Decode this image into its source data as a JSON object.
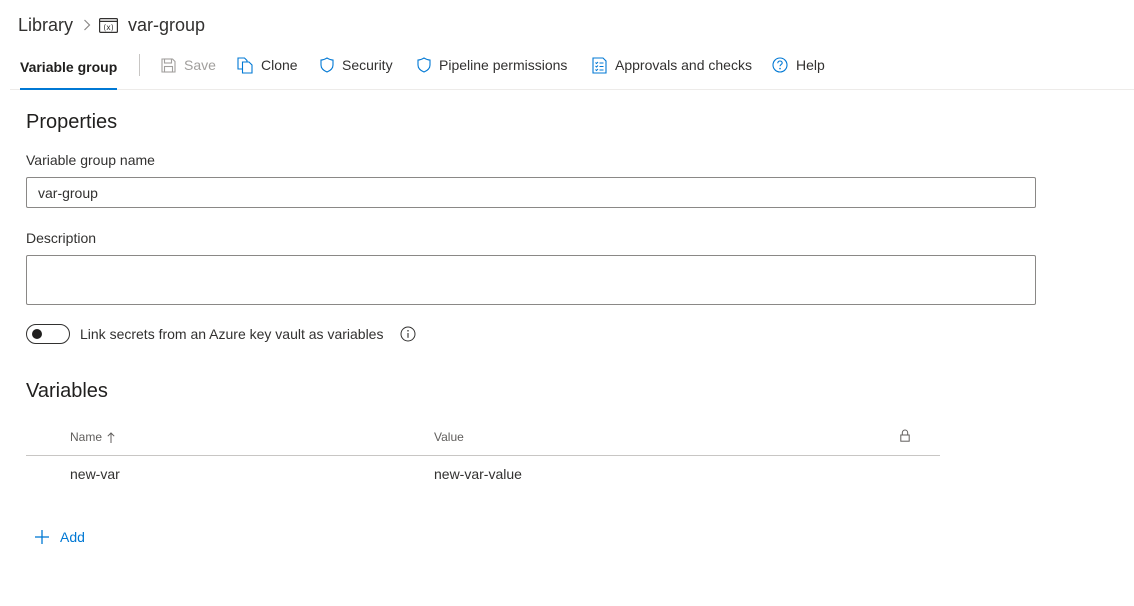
{
  "breadcrumb": {
    "root": "Library",
    "current": "var-group",
    "current_icon": "variable-group-icon"
  },
  "toolbar": {
    "active_tab": "Variable group",
    "save": "Save",
    "clone": "Clone",
    "security": "Security",
    "pipeline_permissions": "Pipeline permissions",
    "approvals_and_checks": "Approvals and checks",
    "help": "Help"
  },
  "properties": {
    "title": "Properties",
    "name_label": "Variable group name",
    "name_value": "var-group",
    "description_label": "Description",
    "description_value": "",
    "key_vault_toggle_label": "Link secrets from an Azure key vault as variables",
    "key_vault_toggle_on": false
  },
  "variables": {
    "title": "Variables",
    "columns": {
      "name": "Name",
      "value": "Value"
    },
    "rows": [
      {
        "name": "new-var",
        "value": "new-var-value",
        "secret": false
      }
    ],
    "add_label": "Add"
  },
  "colors": {
    "accent": "#0078d4",
    "text": "#323130",
    "disabled": "#a19f9d"
  }
}
